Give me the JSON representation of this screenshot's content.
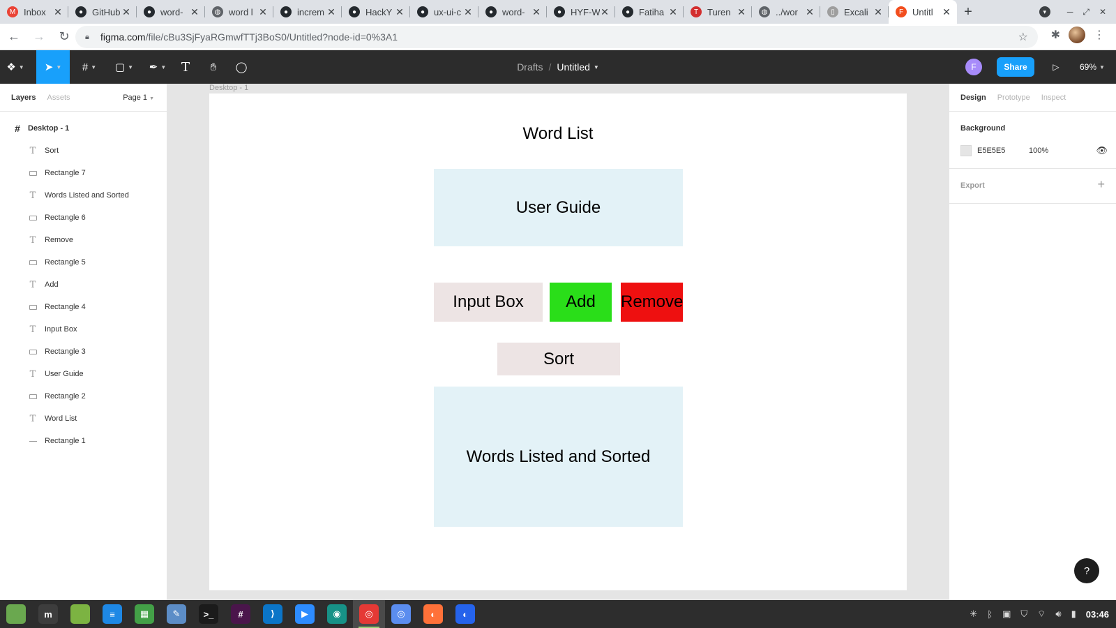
{
  "browser": {
    "tabs": [
      {
        "title": "Inbox",
        "icon": "gmail-icon",
        "color": "#ea4335",
        "glyph": "M"
      },
      {
        "title": "GitHub",
        "icon": "github-icon",
        "color": "#24292e",
        "glyph": "●"
      },
      {
        "title": "word-",
        "icon": "github-icon",
        "color": "#24292e",
        "glyph": "●"
      },
      {
        "title": "word l",
        "icon": "globe-icon",
        "color": "#5f6368",
        "glyph": "◍"
      },
      {
        "title": "increm",
        "icon": "github-icon",
        "color": "#24292e",
        "glyph": "●"
      },
      {
        "title": "HackY",
        "icon": "github-icon",
        "color": "#24292e",
        "glyph": "●"
      },
      {
        "title": "ux-ui-c",
        "icon": "github-icon",
        "color": "#24292e",
        "glyph": "●"
      },
      {
        "title": "word-",
        "icon": "github-icon",
        "color": "#24292e",
        "glyph": "●"
      },
      {
        "title": "HYF-W",
        "icon": "github-icon",
        "color": "#24292e",
        "glyph": "●"
      },
      {
        "title": "Fatiha",
        "icon": "github-icon",
        "color": "#24292e",
        "glyph": "●"
      },
      {
        "title": "Turen",
        "icon": "turen-icon",
        "color": "#d32f2f",
        "glyph": "T"
      },
      {
        "title": "../wor",
        "icon": "globe-icon",
        "color": "#5f6368",
        "glyph": "◍"
      },
      {
        "title": "Excali",
        "icon": "excalidraw-icon",
        "color": "#9e9e9e",
        "glyph": "▯"
      },
      {
        "title": "Untitl",
        "icon": "figma-icon",
        "color": "#f24e1e",
        "glyph": "F",
        "active": true
      }
    ],
    "close_glyph": "✕",
    "new_tab_glyph": "+",
    "url_host": "figma.com",
    "url_path": "/file/cBu3SjFyaRGmwfTTj3BoS0/Untitled?node-id=0%3A1"
  },
  "figma": {
    "breadcrumb": {
      "project": "Drafts",
      "separator": "/",
      "file": "Untitled"
    },
    "avatar_initial": "F",
    "share_label": "Share",
    "zoom": "69%",
    "left_tabs": {
      "layers": "Layers",
      "assets": "Assets"
    },
    "page_selector": "Page 1",
    "layers": [
      {
        "name": "Desktop - 1",
        "type": "frame"
      },
      {
        "name": "Sort",
        "type": "text"
      },
      {
        "name": "Rectangle 7",
        "type": "rect"
      },
      {
        "name": "Words Listed and Sorted",
        "type": "text"
      },
      {
        "name": "Rectangle 6",
        "type": "rect"
      },
      {
        "name": "Remove",
        "type": "text"
      },
      {
        "name": "Rectangle 5",
        "type": "rect"
      },
      {
        "name": "Add",
        "type": "text"
      },
      {
        "name": "Rectangle 4",
        "type": "rect"
      },
      {
        "name": "Input Box",
        "type": "text"
      },
      {
        "name": "Rectangle 3",
        "type": "rect"
      },
      {
        "name": "User Guide",
        "type": "text"
      },
      {
        "name": "Rectangle 2",
        "type": "rect"
      },
      {
        "name": "Word List",
        "type": "text"
      },
      {
        "name": "Rectangle 1",
        "type": "line"
      }
    ],
    "frame_label": "Desktop - 1",
    "design": {
      "title": "Word List",
      "user_guide": "User Guide",
      "input_box": "Input Box",
      "add": "Add",
      "remove": "Remove",
      "sort": "Sort",
      "words_listed": "Words Listed and Sorted"
    },
    "right_tabs": {
      "design": "Design",
      "prototype": "Prototype",
      "inspect": "Inspect"
    },
    "background": {
      "heading": "Background",
      "hex": "E5E5E5",
      "opacity": "100%"
    },
    "export_label": "Export",
    "help_label": "?"
  },
  "taskbar": {
    "apps": [
      {
        "name": "show-desktop",
        "color": "#6aa84f",
        "glyph": ""
      },
      {
        "name": "mint-menu",
        "color": "#3d3d3d",
        "glyph": "m"
      },
      {
        "name": "files",
        "color": "#7cb342",
        "glyph": ""
      },
      {
        "name": "writer",
        "color": "#1e88e5",
        "glyph": "≡"
      },
      {
        "name": "calc",
        "color": "#43a047",
        "glyph": "▦"
      },
      {
        "name": "text-editor",
        "color": "#5c8dc7",
        "glyph": "✎"
      },
      {
        "name": "terminal",
        "color": "#1b1b1b",
        "glyph": ">_"
      },
      {
        "name": "slack",
        "color": "#4a154b",
        "glyph": "#"
      },
      {
        "name": "vscode",
        "color": "#0b75c8",
        "glyph": "⟩"
      },
      {
        "name": "zoom",
        "color": "#2d8cff",
        "glyph": "▶"
      },
      {
        "name": "gitkraken",
        "color": "#179287",
        "glyph": "◉"
      },
      {
        "name": "chrome",
        "color": "#e53935",
        "glyph": "◎",
        "focused": true
      },
      {
        "name": "chromium",
        "color": "#5b8def",
        "glyph": "◎"
      },
      {
        "name": "firefox-dev",
        "color": "#ff7139",
        "glyph": "◐"
      },
      {
        "name": "firefox",
        "color": "#2563eb",
        "glyph": "◐"
      }
    ],
    "clock": "03:46"
  }
}
